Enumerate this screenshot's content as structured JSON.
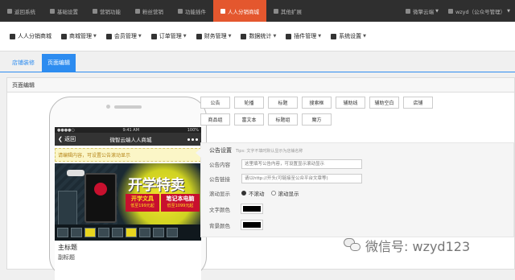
{
  "topnav": {
    "items": [
      {
        "label": "返回系统"
      },
      {
        "label": "基础设置"
      },
      {
        "label": "营销功能"
      },
      {
        "label": "粉丝营销"
      },
      {
        "label": "功能插件"
      },
      {
        "label": "人人分销商城",
        "active": true
      },
      {
        "label": "其他扩展"
      }
    ],
    "right": [
      {
        "label": "微擎云端"
      },
      {
        "label": "wzyd（公众号管理）"
      }
    ]
  },
  "menubar": {
    "items": [
      {
        "label": "人人分销商城",
        "icon": "home-icon"
      },
      {
        "label": "商城管理",
        "icon": "cart-icon"
      },
      {
        "label": "会员管理",
        "icon": "users-icon"
      },
      {
        "label": "订单管理",
        "icon": "list-icon"
      },
      {
        "label": "财务管理",
        "icon": "money-icon"
      },
      {
        "label": "数据统计",
        "icon": "bar-chart-icon"
      },
      {
        "label": "插件管理",
        "icon": "puzzle-icon"
      },
      {
        "label": "系统设置",
        "icon": "gear-icon"
      }
    ]
  },
  "tabs": [
    {
      "label": "店铺装修",
      "active": false
    },
    {
      "label": "页面编辑",
      "active": true
    }
  ],
  "panel": {
    "heading": "页面编辑"
  },
  "phone": {
    "status_left": "●●●●○",
    "status_time": "9:41 AM",
    "status_right": "100%",
    "back_label": "返回",
    "nav_title": "微智云端人人商城",
    "notice": "请编辑内容，可设置公告滚动显示",
    "banner": {
      "big": "开学特卖",
      "card1_title": "开学文具",
      "card1_price": "低至199元起",
      "card2_title": "笔记本电脑",
      "card2_price": "低至1099元起"
    },
    "main_title": "主标题",
    "sub_title": "副标题"
  },
  "components": {
    "row1": [
      "公告",
      "轮播",
      "标题",
      "搜索框",
      "辅助线",
      "辅助空白",
      "店铺"
    ],
    "row2": [
      "商品组",
      "富文本",
      "标题组",
      "魔方"
    ]
  },
  "editor": {
    "title": "公告设置",
    "tip": "Tips: 文字不填时默认显示为店铺名称",
    "fields": {
      "content_label": "公告内容",
      "content_placeholder": "这里填写公告内容，可设置显示滚动显示",
      "link_label": "公告链接",
      "link_placeholder": "请以http://开头(可链接至公众平台文章等)",
      "scroll_label": "滚动显示",
      "scroll_options": [
        "不滚动",
        "滚动显示"
      ],
      "scroll_selected": 0,
      "text_color_label": "文字颜色",
      "bg_color_label": "背景颜色",
      "text_color": "#000000",
      "bg_color": "#000000"
    }
  },
  "watermark": {
    "text": "微信号: wzyd123"
  },
  "colors": {
    "accent": "#e4572e",
    "tab_blue": "#2d8cf0",
    "topbar": "#2f2f2f"
  }
}
